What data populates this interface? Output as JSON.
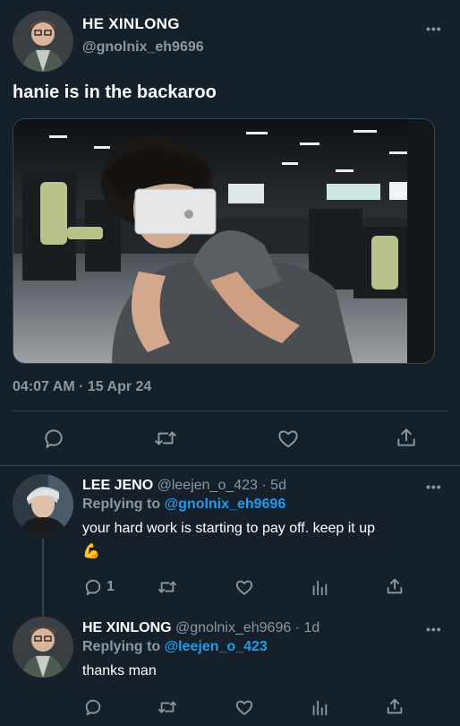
{
  "main_tweet": {
    "display_name": "HE XINLONG",
    "handle": "@gnolnix_eh9696",
    "more": "•••",
    "text": "hanie is in the backaroo",
    "timestamp": "04:07 AM · 15 Apr 24"
  },
  "replies": [
    {
      "display_name": "LEE JENO",
      "handle": "@leejen_o_423",
      "age": "· 5d",
      "replying_prefix": "Replying to",
      "replying_handle": "@gnolnix_eh9696",
      "text": "your hard work is starting to pay off. keep it up",
      "emoji": "💪",
      "reply_count": "1",
      "more": "•••"
    },
    {
      "display_name": "HE XINLONG",
      "handle": "@gnolnix_eh9696",
      "age": "· 1d",
      "replying_prefix": "Replying to",
      "replying_handle": "@leejen_o_423",
      "text": "thanks man",
      "more": "•••"
    }
  ],
  "colors": {
    "background": "#15202b",
    "muted": "#8899a6",
    "accent": "#1d9bf0",
    "divider": "#38444d"
  },
  "icons": [
    "reply-icon",
    "retweet-icon",
    "like-icon",
    "share-icon",
    "analytics-icon",
    "more-icon"
  ]
}
